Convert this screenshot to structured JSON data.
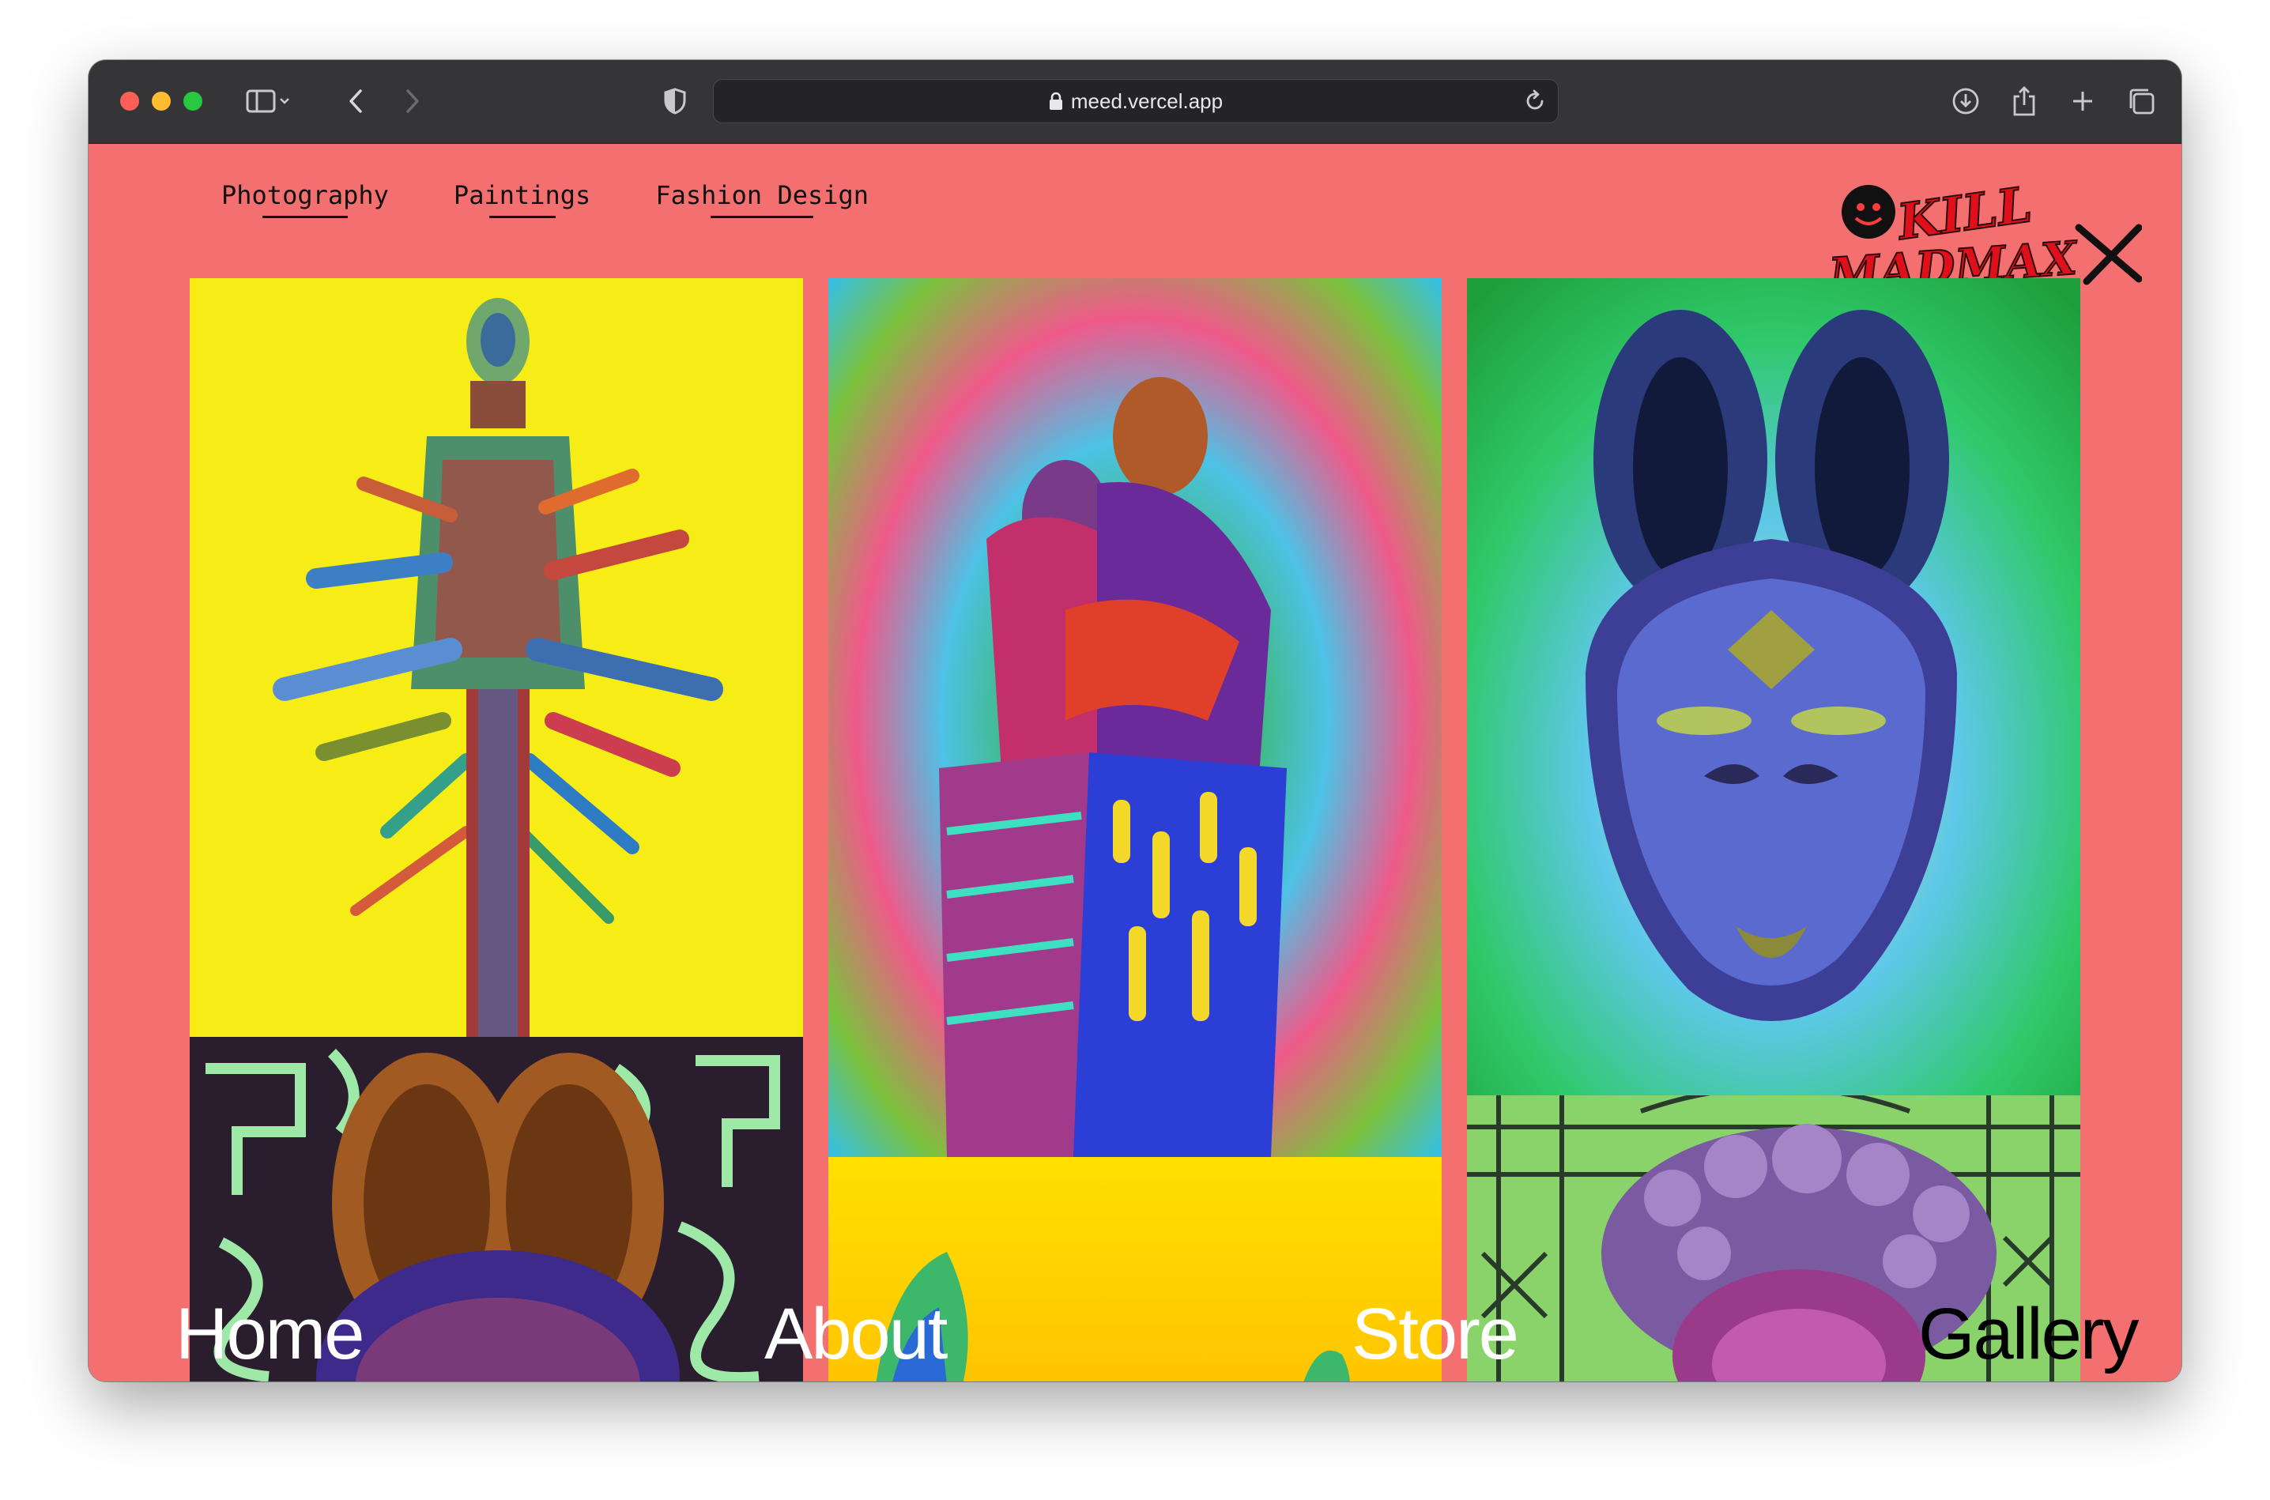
{
  "browser": {
    "url": "meed.vercel.app"
  },
  "nav": {
    "items": [
      {
        "label": "Photography"
      },
      {
        "label": "Paintings"
      },
      {
        "label": "Fashion Design"
      }
    ]
  },
  "logo": {
    "text_top": "KILL",
    "text_bottom": "MADMAX"
  },
  "gallery": {
    "tiles": [
      {
        "desc": "figure-sculpture-yellow",
        "bg": "#f6ec16"
      },
      {
        "desc": "mask-pattern-dark",
        "bg": "#2a1d2e"
      },
      {
        "desc": "embracing-figures-psychedelic",
        "bg": "#e85b7a"
      },
      {
        "desc": "yellow-tile",
        "bg": "#ffd400"
      },
      {
        "desc": "mask-green-blue",
        "bg": "#27c45a"
      },
      {
        "desc": "head-pattern-green",
        "bg": "#8ad36b"
      }
    ]
  },
  "bottom_nav": {
    "home": "Home",
    "about": "About",
    "store": "Store",
    "gallery": "Gallery"
  },
  "colors": {
    "page_bg": "#f47070",
    "toolbar": "#353538"
  }
}
